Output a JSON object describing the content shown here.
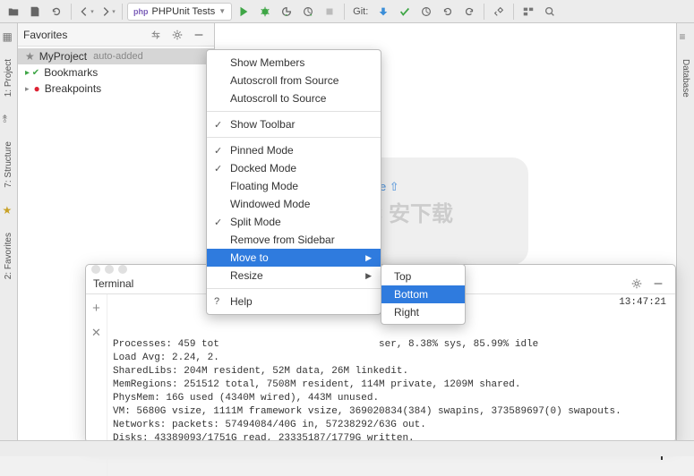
{
  "toolbar": {
    "run_config": "PHPUnit Tests",
    "git_label": "Git:"
  },
  "left_tabs": [
    "1: Project",
    "7: Structure",
    "2: Favorites"
  ],
  "right_tabs": [
    "Database"
  ],
  "favorites": {
    "title": "Favorites",
    "items": [
      {
        "icon": "star",
        "label": "MyProject",
        "badge": "auto-added",
        "selected": true
      },
      {
        "icon": "check",
        "label": "Bookmarks"
      },
      {
        "icon": "dot-red",
        "label": "Breakpoints"
      }
    ]
  },
  "editor_hint": "Double ⇧",
  "context_menu": {
    "groups": [
      [
        {
          "label": "Show Members"
        },
        {
          "label": "Autoscroll from Source"
        },
        {
          "label": "Autoscroll to Source"
        }
      ],
      [
        {
          "label": "Show Toolbar",
          "checked": true
        }
      ],
      [
        {
          "label": "Pinned Mode",
          "checked": true
        },
        {
          "label": "Docked Mode",
          "checked": true
        },
        {
          "label": "Floating Mode"
        },
        {
          "label": "Windowed Mode"
        },
        {
          "label": "Split Mode",
          "checked": true
        },
        {
          "label": "Remove from Sidebar"
        },
        {
          "label": "Move to",
          "submenu": true,
          "highlighted": true
        },
        {
          "label": "Resize",
          "submenu": true
        }
      ],
      [
        {
          "label": "Help",
          "help": true
        }
      ]
    ],
    "submenu": [
      {
        "label": "Top"
      },
      {
        "label": "Bottom",
        "highlighted": true
      },
      {
        "label": "Right"
      }
    ]
  },
  "terminal": {
    "title": "Terminal",
    "time": "13:47:21",
    "lines": [
      "Processes: 459 tot                           ser, 8.38% sys, 85.99% idle",
      "Load Avg: 2.24, 2.",
      "SharedLibs: 204M resident, 52M data, 26M linkedit.",
      "MemRegions: 251512 total, 7508M resident, 114M private, 1209M shared.",
      "PhysMem: 16G used (4340M wired), 443M unused.",
      "VM: 5680G vsize, 1111M framework vsize, 369020834(384) swapins, 373589697(0) swapouts.",
      "Networks: packets: 57494084/40G in, 57238292/63G out.",
      "Disks: 43389093/1751G read, 23335187/1779G written."
    ]
  }
}
